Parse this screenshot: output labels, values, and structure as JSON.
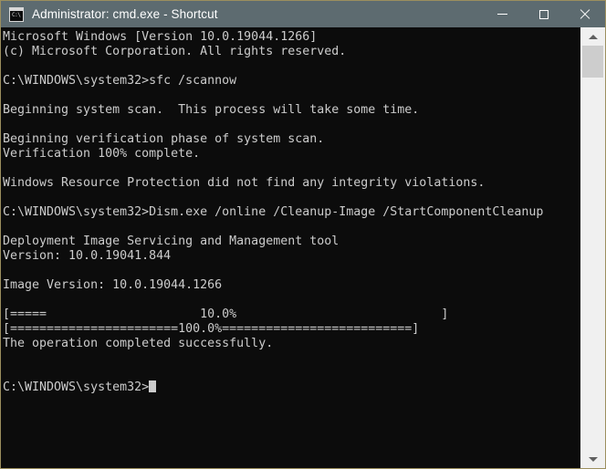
{
  "window": {
    "title": "Administrator: cmd.exe - Shortcut",
    "icon": "cmd-console-icon",
    "icon_prompt": "C:\\",
    "titlebar_color": "#5d6b70",
    "border_color": "#9c8f5e",
    "console_bg": "#0c0c0c",
    "console_fg": "#cccccc"
  },
  "controls": {
    "minimize_label": "Minimize",
    "maximize_label": "Maximize",
    "close_label": "Close"
  },
  "scrollbar": {
    "up_label": "Scroll up",
    "down_label": "Scroll down",
    "thumb_label": "Scroll thumb"
  },
  "console": {
    "lines": [
      "Microsoft Windows [Version 10.0.19044.1266]",
      "(c) Microsoft Corporation. All rights reserved.",
      "",
      "C:\\WINDOWS\\system32>sfc /scannow",
      "",
      "Beginning system scan.  This process will take some time.",
      "",
      "Beginning verification phase of system scan.",
      "Verification 100% complete.",
      "",
      "Windows Resource Protection did not find any integrity violations.",
      "",
      "C:\\WINDOWS\\system32>Dism.exe /online /Cleanup-Image /StartComponentCleanup",
      "",
      "Deployment Image Servicing and Management tool",
      "Version: 10.0.19041.844",
      "",
      "Image Version: 10.0.19044.1266",
      "",
      "[=====                     10.0%                            ]",
      "[=======================100.0%==========================]",
      "The operation completed successfully.",
      "",
      ""
    ],
    "prompt": "C:\\WINDOWS\\system32>",
    "cursor": "_"
  }
}
